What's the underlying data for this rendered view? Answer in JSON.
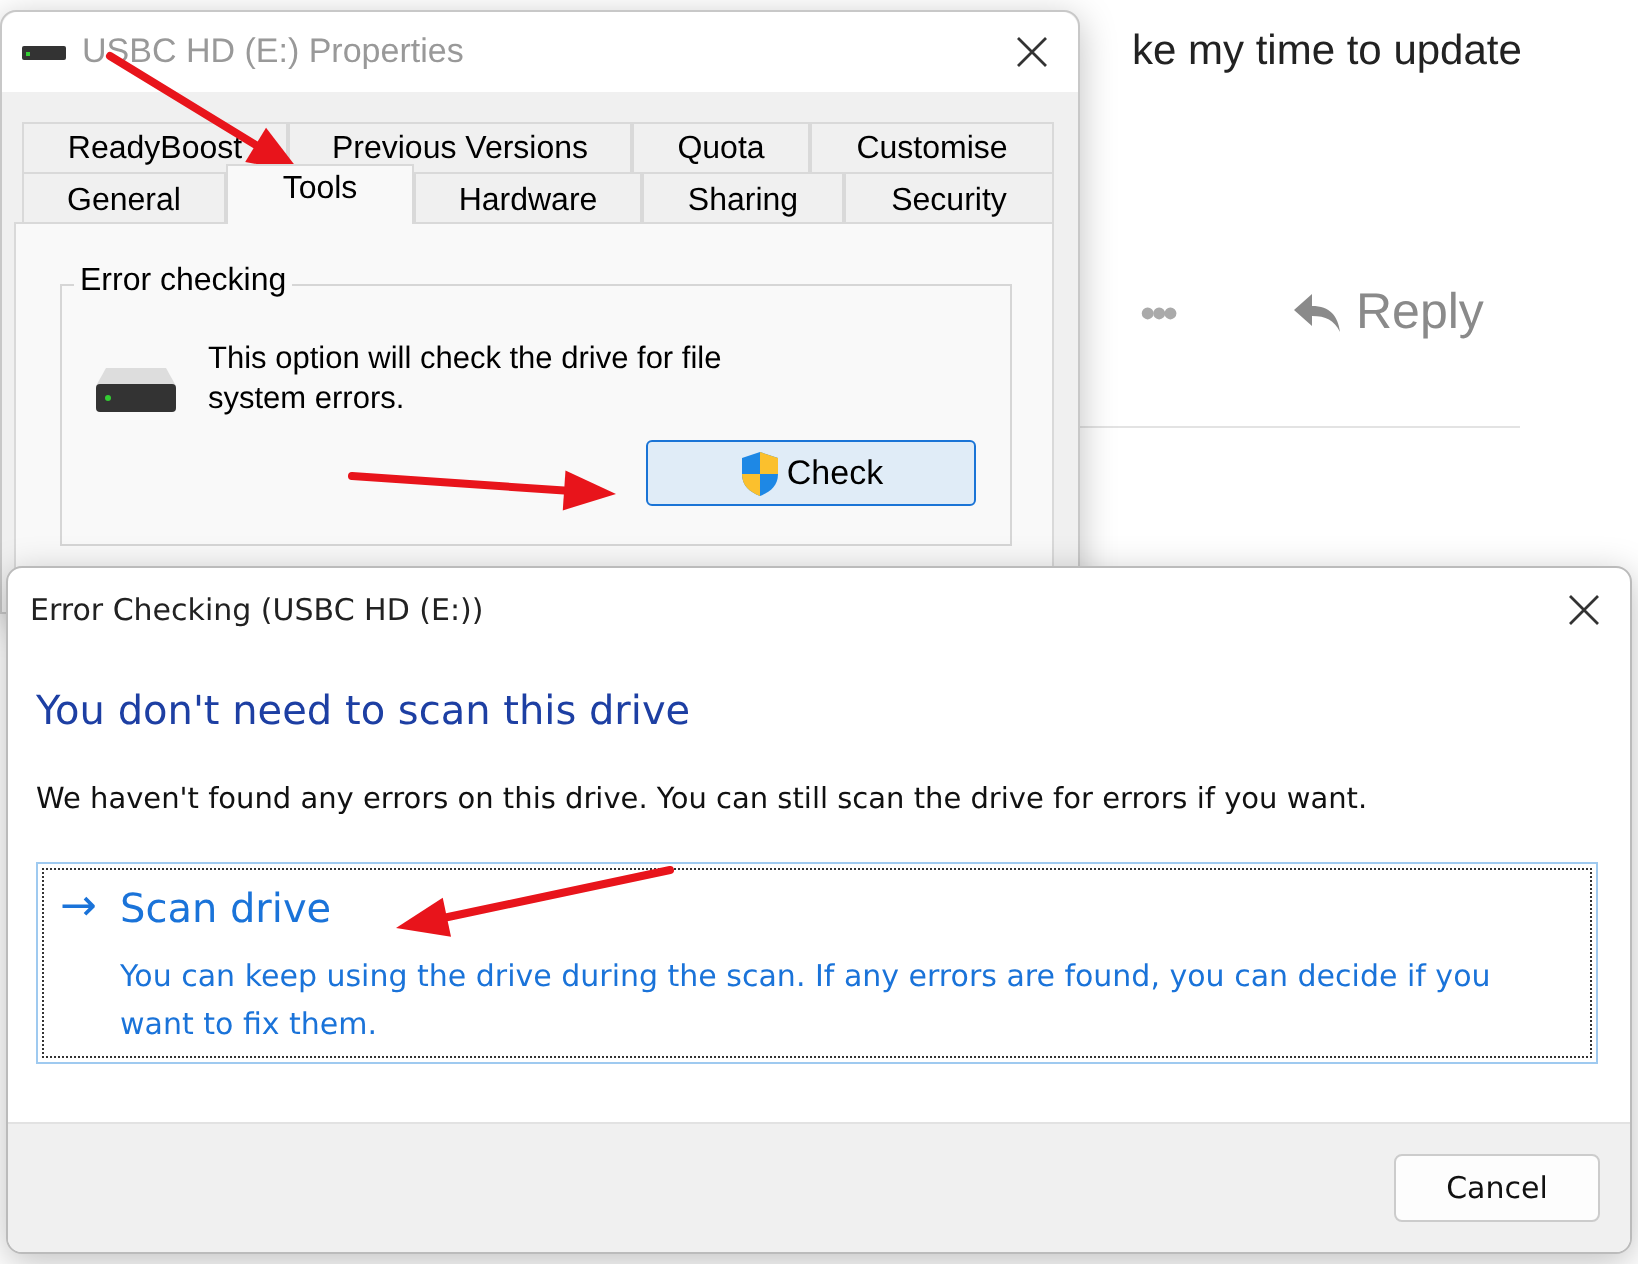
{
  "background_page": {
    "text": "ke my time to update",
    "more": "•••",
    "reply": "Reply"
  },
  "properties_window": {
    "title": "USBC HD (E:) Properties",
    "tab_rows": [
      [
        {
          "label": "ReadyBoost",
          "selected": false
        },
        {
          "label": "Previous Versions",
          "selected": false
        },
        {
          "label": "Quota",
          "selected": false
        },
        {
          "label": "Customise",
          "selected": false
        }
      ],
      [
        {
          "label": "General",
          "selected": false
        },
        {
          "label": "Tools",
          "selected": true
        },
        {
          "label": "Hardware",
          "selected": false
        },
        {
          "label": "Sharing",
          "selected": false
        },
        {
          "label": "Security",
          "selected": false
        }
      ]
    ],
    "group": {
      "title": "Error checking",
      "text": "This option will check the drive for file system errors.",
      "button": "Check"
    }
  },
  "error_dialog": {
    "title": "Error Checking (USBC HD (E:))",
    "heading": "You don't need to scan this drive",
    "message": "We haven't found any errors on this drive. You can still scan the drive for errors if you want.",
    "option": {
      "arrow": "→",
      "title": "Scan drive",
      "description": "You can keep using the drive during the scan. If any errors are found, you can decide if you want to fix them."
    },
    "buttons": [
      "Cancel"
    ]
  }
}
